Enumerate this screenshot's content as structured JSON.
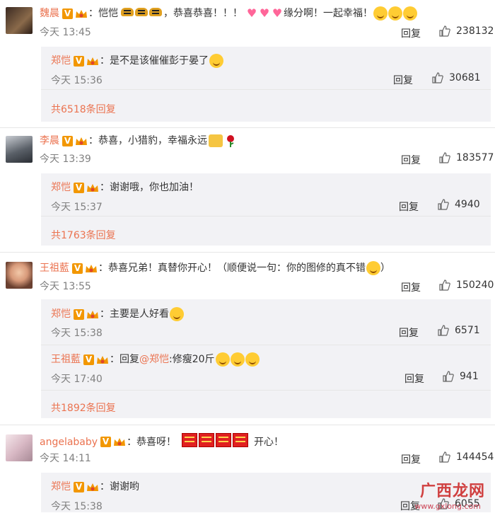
{
  "colors": {
    "username": "#eb7350",
    "badge": "#f29700",
    "sub_bg": "#f2f2f5"
  },
  "reply_label": "回复",
  "comments": [
    {
      "user": "魏晨",
      "text": "：恺恺",
      "text_after_tigers": "，恭喜恭喜！！！",
      "text_after_hearts": "缘分啊！一起幸福！",
      "time": "今天 13:45",
      "likes": "238132",
      "replies": [
        {
          "user": "郑恺",
          "text": "：是不是该催催彭于晏了",
          "time": "今天 15:36",
          "likes": "30681"
        }
      ],
      "more": "共6518条回复"
    },
    {
      "user": "李晨",
      "text": "：恭喜，小猎豹，幸福永远",
      "time": "今天 13:39",
      "likes": "183577",
      "replies": [
        {
          "user": "郑恺",
          "text": "：谢谢哦，你也加油！",
          "time": "今天 15:37",
          "likes": "4940"
        }
      ],
      "more": "共1763条回复"
    },
    {
      "user": "王祖藍",
      "text": "：恭喜兄弟！真替你开心！（顺便说一句：你的图修的真不错",
      "text_end": "）",
      "time": "今天 13:55",
      "likes": "150240",
      "replies": [
        {
          "user": "郑恺",
          "text": "：主要是人好看",
          "time": "今天 15:38",
          "likes": "6571"
        },
        {
          "user": "王祖藍",
          "text_pre": "：回复",
          "mention": "@郑恺",
          "text": ":修瘦20斤",
          "time": "今天 17:40",
          "likes": "941"
        }
      ],
      "more": "共1892条回复"
    },
    {
      "user": "angelababy",
      "text": "：恭喜呀！",
      "text_after": "开心！",
      "time": "今天 14:11",
      "likes": "144454",
      "replies": [
        {
          "user": "郑恺",
          "text": "：谢谢哟",
          "time": "今天 15:38",
          "likes": "6055"
        }
      ]
    }
  ],
  "watermark": {
    "main": "广西龙网",
    "sub": "www.gxlong.com"
  }
}
